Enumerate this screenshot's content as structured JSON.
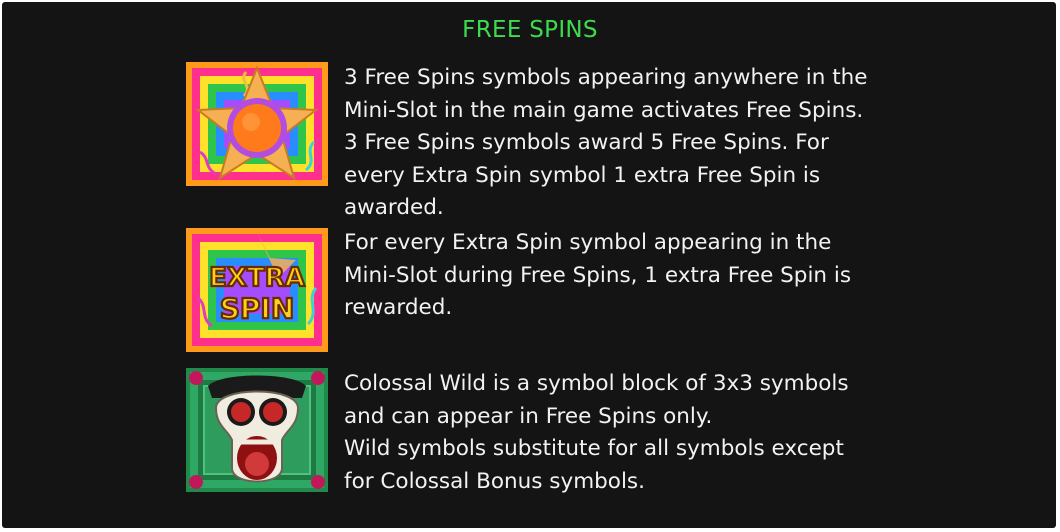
{
  "title": "FREE SPINS",
  "rows": [
    {
      "icon": "pinata-star-icon",
      "lines": [
        "3 Free Spins symbols appearing anywhere in the",
        "Mini-Slot in the main game activates Free Spins.",
        "3 Free Spins symbols award 5 Free Spins. For",
        "every Extra Spin symbol 1 extra Free Spin is",
        "awarded."
      ]
    },
    {
      "icon": "extra-spin-icon",
      "icon_text": [
        "EXTRA",
        "SPIN"
      ],
      "lines": [
        "For every Extra Spin symbol appearing in the",
        "Mini-Slot during Free Spins, 1 extra Free Spin is",
        "rewarded."
      ]
    },
    {
      "icon": "colossal-wild-skull-icon",
      "lines": [
        "Colossal Wild is a symbol block of 3x3 symbols",
        "and can appear in Free Spins only.",
        "Wild symbols substitute for all symbols except",
        "for Colossal Bonus symbols."
      ]
    }
  ],
  "colors": {
    "background": "#141414",
    "title": "#3ddc4f",
    "text": "#f2f2f2"
  }
}
